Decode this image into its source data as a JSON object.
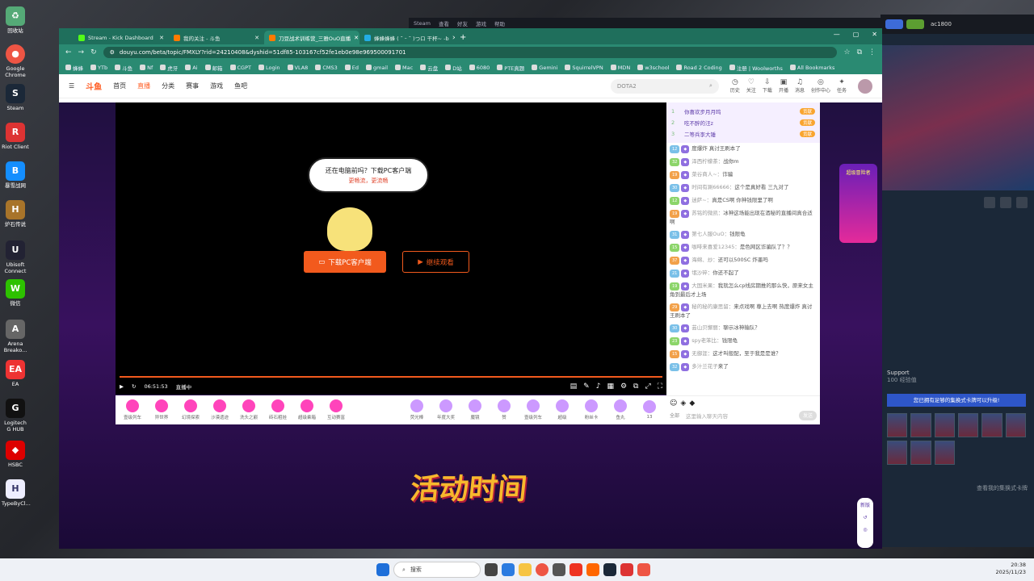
{
  "desktop": {
    "icons": [
      "回收站",
      "Google Chrome",
      "Steam",
      "Riot Client",
      "暴雪战网",
      "炉石传说",
      "Ubisoft Connect",
      "微信",
      "Arena Breako...",
      "EA",
      "Logitech G HUB",
      "HSBC",
      "TypeByCl..."
    ]
  },
  "steam_window": {
    "user": "ac1800",
    "friend_label": "Support",
    "friend_status": "100 经验值",
    "banner": "您已拥有足够的集换式卡牌可以升级!",
    "link_cards": "查看我的集换式卡牌"
  },
  "steam_bar": {
    "items": [
      "Steam",
      "查看",
      "好友",
      "游戏",
      "帮助"
    ]
  },
  "browser": {
    "tabs": [
      {
        "title": "Stream - Kick Dashboard"
      },
      {
        "title": "我的关注 - 斗鱼"
      },
      {
        "title": "刀豆战术训练营_三雅OuO直播"
      },
      {
        "title": "蜂蜂蜂蜂 ( ˘ ᵕ ˘ )つロ 干杯~ -b"
      }
    ],
    "url": "douyu.com/beta/topic/FMXLY?rid=24210408&dyshid=51df85-103167cf52fe1eb0e98e969500091701",
    "bookmarks": [
      "蜂蜂",
      "YTb",
      "斗鱼",
      "Nf",
      "虎牙",
      "Ai",
      "邮箱",
      "CGPT",
      "Login",
      "VLA8",
      "CMS3",
      "Ed",
      "gmail",
      "Mac",
      "云盘",
      "D站",
      "6080",
      "PTE真题",
      "Gemini",
      "SquirrelVPN",
      "MDN",
      "w3school",
      "Road 2 Coding",
      "注册 | Woolworths",
      "All Bookmarks"
    ]
  },
  "site": {
    "logo": "斗鱼",
    "nav": [
      "首页",
      "直播",
      "分类",
      "赛事",
      "游戏",
      "鱼吧"
    ],
    "search_placeholder": "DOTA2",
    "tools": [
      "历史",
      "关注",
      "下载",
      "开播",
      "消息",
      "创作中心",
      "任务"
    ]
  },
  "player": {
    "bubble_text": "还在电脑前吗？下载PC客户端",
    "bubble_sub": "更畅流，更流畅",
    "download_btn": "下载PC客户端",
    "watch_btn": "继续观看",
    "time": "06:51:53",
    "live_label": "直播中"
  },
  "gifts": [
    "壹级列车",
    "异世界",
    "幻境探索",
    "沙漠遗迹",
    "洗头之巅",
    "砖石粗娃",
    "超级乘箱",
    "互动赛富"
  ],
  "gifts_right": [
    "荧光棒",
    "年度大奖",
    "魔镜",
    "赞",
    "壹级列车",
    "超级",
    "粉丝卡",
    "鱼丸",
    "13"
  ],
  "chat": {
    "ranks": [
      {
        "n": "1",
        "name": "你喜欢步月月鸣",
        "tag": "贡献"
      },
      {
        "n": "2",
        "name": "吃不醉的汪z",
        "tag": "贡献"
      },
      {
        "n": "3",
        "name": "二等兵李大锤",
        "tag": "贡献"
      }
    ],
    "messages": [
      {
        "lv": "12",
        "user": "",
        "text": "度爆炸 真讨王刷本了"
      },
      {
        "lv": "32",
        "user": "泽西柠檬茶：",
        "text": "战你m"
      },
      {
        "lv": "19",
        "user": "菜谷商人~：",
        "text": "诈骗"
      },
      {
        "lv": "30",
        "user": "时间有涮66666：",
        "text": "这个是真好看 三九对了"
      },
      {
        "lv": "12",
        "user": "迷萨~：",
        "text": "真是CS啊 你神钱限里了啊"
      },
      {
        "lv": "19",
        "user": "苏铭的微凯：",
        "text": "冰神这场能出现在酒秘的直播间真合适啊"
      },
      {
        "lv": "31",
        "user": "第七人服OuO：",
        "text": "钱限龟"
      },
      {
        "lv": "15",
        "user": "咖啡来喜爱12345：",
        "text": "是色网区诈骗队了？？"
      },
      {
        "lv": "37",
        "user": "海绵、炒：",
        "text": "还可以500SC 炸墨吗"
      },
      {
        "lv": "21",
        "user": "氓沙碎：",
        "text": "你还不起了"
      },
      {
        "lv": "19",
        "user": "大国米果：",
        "text": "我就怎么cp线房期推的那么快，原来女主角到最后才上场"
      },
      {
        "lv": "29",
        "user": "秘的秘的康思留：",
        "text": "来点戏啊 尊上去啊 热度爆炸 真讨王刷本了"
      },
      {
        "lv": "30",
        "user": "芸山贝懈丽：",
        "text": "聊示冰神输队？"
      },
      {
        "lv": "23",
        "user": "spy老笨比：",
        "text": "钱限龟"
      },
      {
        "lv": "15",
        "user": "无御涯：",
        "text": "这才叫般配，至于我是是谁？"
      },
      {
        "lv": "32",
        "user": "多汁兰花子",
        "text": "来了"
      }
    ],
    "input_placeholder": "这里输入聊天内容",
    "send": "发送",
    "expand": "全部",
    "side_ad": "超级冒险者"
  },
  "activity_title": "活动时间",
  "taskbar": {
    "search": "搜索",
    "time": "20:38",
    "date": "2025/11/23"
  }
}
